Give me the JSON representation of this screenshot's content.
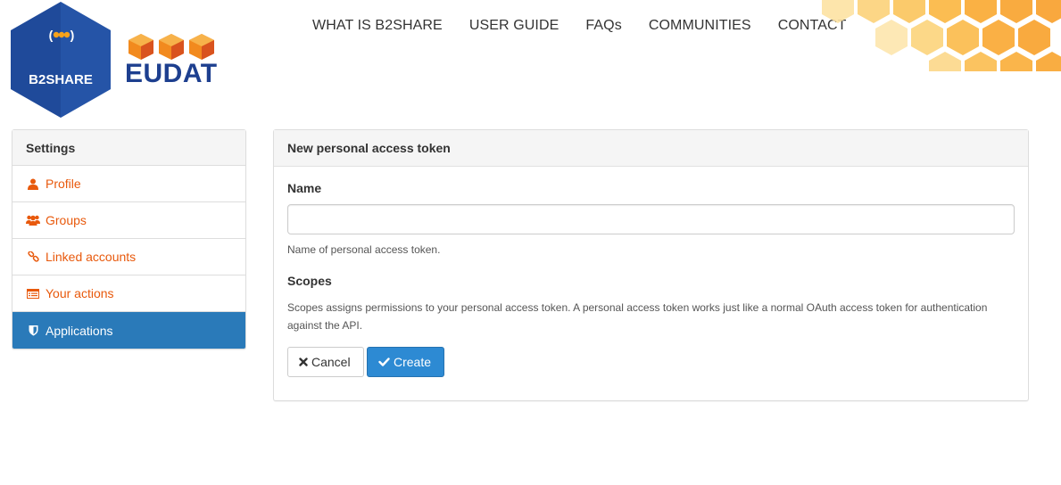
{
  "brand": {
    "b2share_logo_text": "B2SHARE",
    "eudat_logo_text": "EUDAT",
    "primary_color": "#2a7ab9",
    "accent_color": "#e8590c"
  },
  "nav": {
    "items": [
      {
        "label": "WHAT IS B2SHARE"
      },
      {
        "label": "USER GUIDE"
      },
      {
        "label": "FAQs"
      },
      {
        "label": "COMMUNITIES"
      },
      {
        "label": "CONTACT"
      }
    ]
  },
  "sidebar": {
    "heading": "Settings",
    "items": [
      {
        "label": "Profile",
        "icon": "user-icon"
      },
      {
        "label": "Groups",
        "icon": "users-icon"
      },
      {
        "label": "Linked accounts",
        "icon": "link-icon"
      },
      {
        "label": "Your actions",
        "icon": "list-icon"
      },
      {
        "label": "Applications",
        "icon": "shield-icon",
        "active": true
      }
    ]
  },
  "form": {
    "title": "New personal access token",
    "name_label": "Name",
    "name_value": "",
    "name_help": "Name of personal access token.",
    "scopes_label": "Scopes",
    "scopes_help": "Scopes assigns permissions to your personal access token. A personal access token works just like a normal OAuth access token for authentication against the API.",
    "cancel_label": "Cancel",
    "create_label": "Create"
  }
}
